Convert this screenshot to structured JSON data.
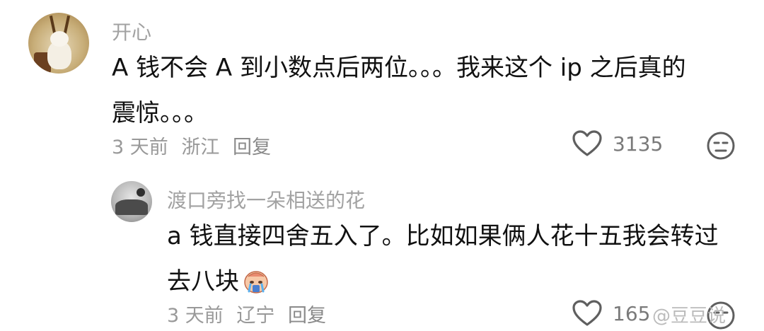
{
  "comment": {
    "username": "开心",
    "text": "A 钱不会 A 到小数点后两位。。。我来这个 ip 之后真的震惊。。。",
    "time": "3 天前",
    "location": "浙江",
    "reply_label": "回复",
    "likes": "3135",
    "avatar_icon": "avatar-teddy-bear"
  },
  "reply": {
    "username": "渡口旁找一朵相送的花",
    "text": "a 钱直接四舍五入了。比如如果俩人花十五我会转过去八块",
    "emoji": "crying-emoji",
    "time": "3 天前",
    "location": "辽宁",
    "reply_label": "回复",
    "likes": "165",
    "avatar_icon": "avatar-gray"
  },
  "watermark": {
    "text": "@豆豆说"
  },
  "colors": {
    "username": "#a2a2a2",
    "text": "#111111",
    "meta": "#999999",
    "icon": "#5f5f5f"
  }
}
